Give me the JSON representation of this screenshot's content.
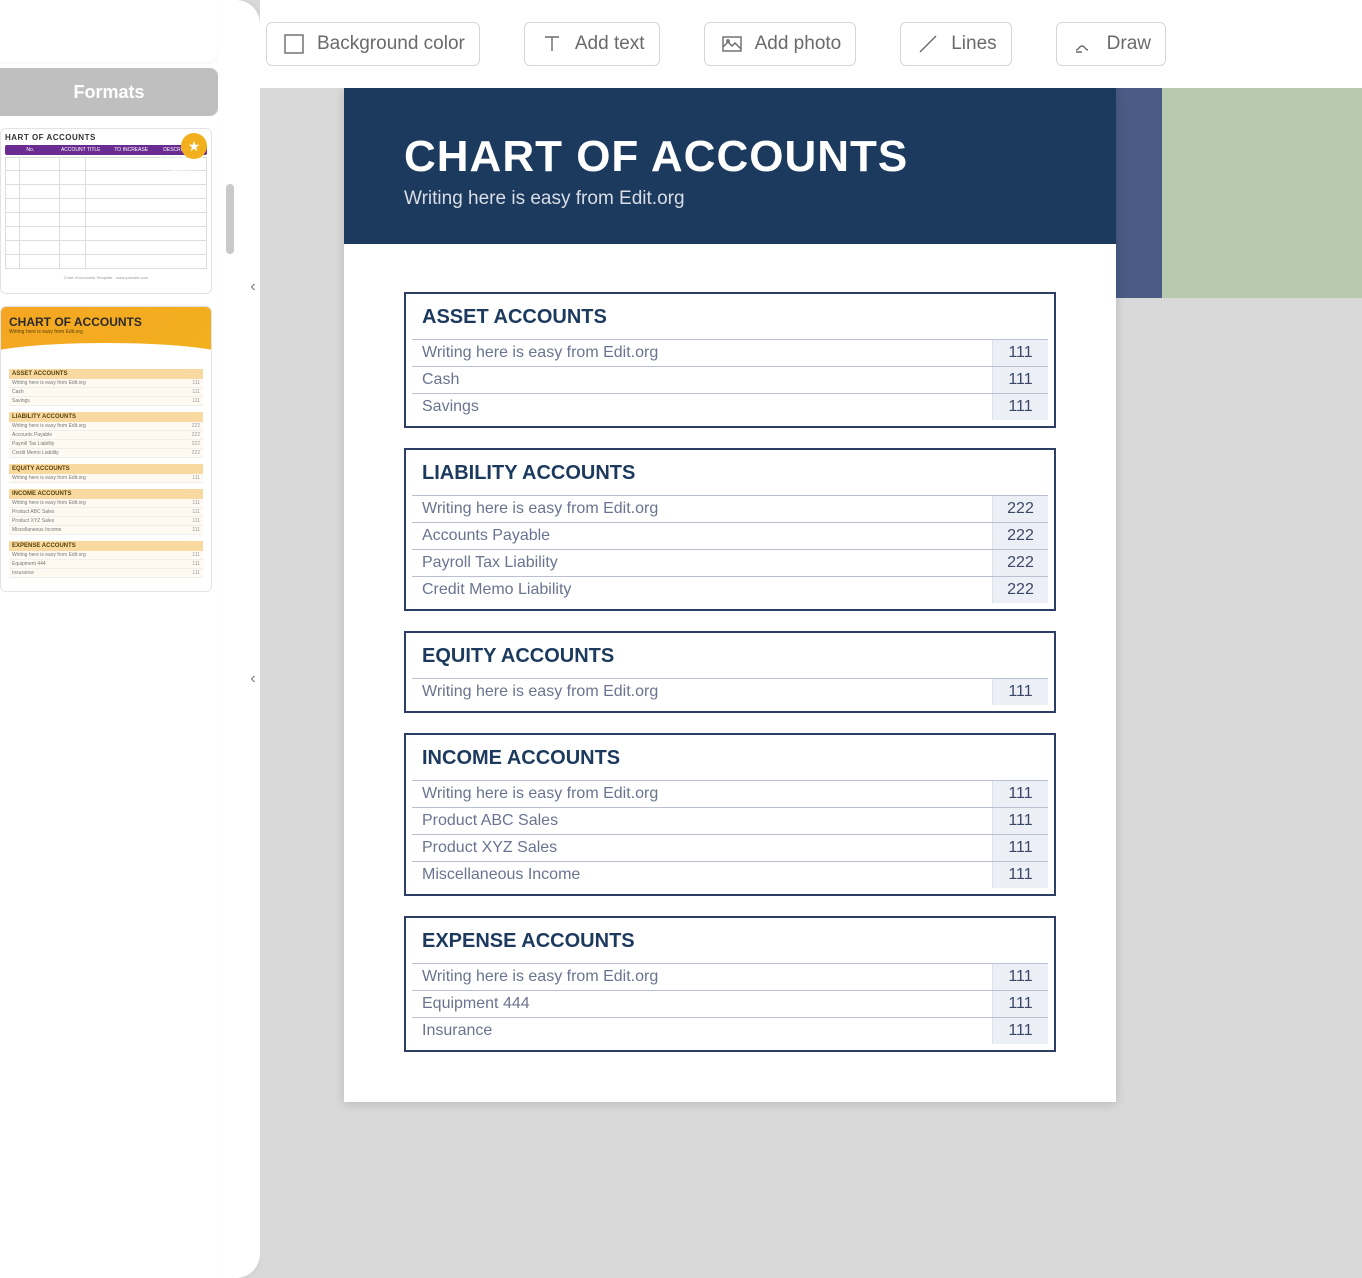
{
  "sidebar": {
    "formats_label": "Formats",
    "thumb1": {
      "title": "HART OF ACCOUNTS",
      "headers": [
        "No.",
        "ACCOUNT TITLE",
        "TO INCREASE",
        "DESCRIPTION / EXPLANATION OF ACCOUNT"
      ],
      "footer": "Chart of Accounts Template - www.yoursite.com"
    },
    "thumb2": {
      "title": "CHART OF ACCOUNTS",
      "subtitle": "Writing here is easy from Edit.org",
      "sections": [
        {
          "h": "ASSET ACCOUNTS",
          "rows": [
            [
              "Writing here is easy from Edit.org",
              "111"
            ],
            [
              "Cash",
              "111"
            ],
            [
              "Savings",
              "111"
            ]
          ]
        },
        {
          "h": "LIABILITY ACCOUNTS",
          "rows": [
            [
              "Writing here is easy from Edit.org",
              "222"
            ],
            [
              "Accounts Payable",
              "222"
            ],
            [
              "Payroll Tax Liability",
              "222"
            ],
            [
              "Credit Memo Liability",
              "222"
            ]
          ]
        },
        {
          "h": "EQUITY ACCOUNTS",
          "rows": [
            [
              "Writing here is easy from Edit.org",
              "111"
            ]
          ]
        },
        {
          "h": "INCOME ACCOUNTS",
          "rows": [
            [
              "Writing here is easy from Edit.org",
              "111"
            ],
            [
              "Product ABC Sales",
              "111"
            ],
            [
              "Product XYZ Sales",
              "111"
            ],
            [
              "Miscellaneous Income",
              "111"
            ]
          ]
        },
        {
          "h": "EXPENSE ACCOUNTS",
          "rows": [
            [
              "Writing here is easy from Edit.org",
              "111"
            ],
            [
              "Equipment 444",
              "111"
            ],
            [
              "Insurance",
              "111"
            ]
          ]
        }
      ]
    }
  },
  "toolbar": {
    "bg_color": "Background color",
    "add_text": "Add text",
    "add_photo": "Add photo",
    "lines": "Lines",
    "draw": "Draw"
  },
  "document": {
    "title": "CHART OF ACCOUNTS",
    "subtitle": "Writing here is easy from Edit.org",
    "sections": [
      {
        "title": "ASSET ACCOUNTS",
        "rows": [
          {
            "label": "Writing here is easy from Edit.org",
            "val": "111"
          },
          {
            "label": "Cash",
            "val": "111"
          },
          {
            "label": "Savings",
            "val": "111"
          }
        ]
      },
      {
        "title": "LIABILITY ACCOUNTS",
        "rows": [
          {
            "label": "Writing here is easy from Edit.org",
            "val": "222"
          },
          {
            "label": "Accounts Payable",
            "val": "222"
          },
          {
            "label": "Payroll Tax Liability",
            "val": "222"
          },
          {
            "label": "Credit Memo Liability",
            "val": "222"
          }
        ]
      },
      {
        "title": "EQUITY ACCOUNTS",
        "rows": [
          {
            "label": "Writing here is easy from Edit.org",
            "val": "111"
          }
        ]
      },
      {
        "title": "INCOME ACCOUNTS",
        "rows": [
          {
            "label": "Writing here is easy from Edit.org",
            "val": "111"
          },
          {
            "label": "Product ABC Sales",
            "val": "111"
          },
          {
            "label": "Product XYZ Sales",
            "val": "111"
          },
          {
            "label": "Miscellaneous Income",
            "val": "111"
          }
        ]
      },
      {
        "title": "EXPENSE ACCOUNTS",
        "rows": [
          {
            "label": "Writing here is easy from Edit.org",
            "val": "111"
          },
          {
            "label": "Equipment 444",
            "val": "111"
          },
          {
            "label": "Insurance",
            "val": "111"
          }
        ]
      }
    ]
  }
}
